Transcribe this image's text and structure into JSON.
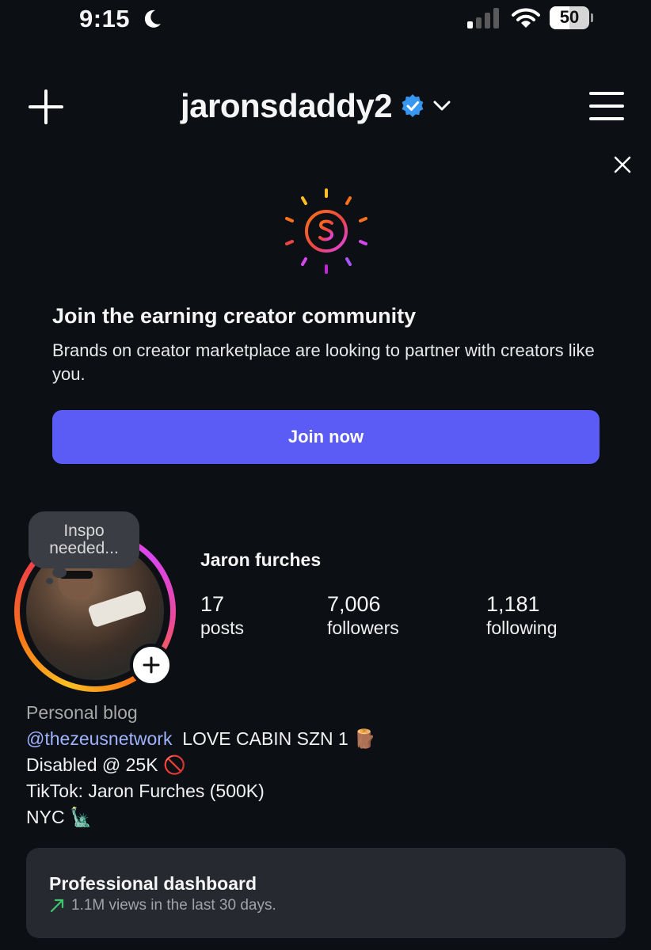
{
  "status_bar": {
    "time": "9:15",
    "battery_percent": "50",
    "battery_level": 0.5,
    "icons": [
      "moon-icon",
      "signal-icon",
      "wifi-icon",
      "battery-icon"
    ]
  },
  "header": {
    "username": "jaronsdaddy2",
    "icons": [
      "plus-icon",
      "verified-badge-icon",
      "chevron-down-icon",
      "menu-icon"
    ]
  },
  "creator_card": {
    "title": "Join the earning creator community",
    "description": "Brands on creator marketplace are looking to partner with creators like you.",
    "button_label": "Join now",
    "icons": [
      "dollar-coin-icon",
      "close-icon"
    ],
    "button_color": "#5b5cf6"
  },
  "profile": {
    "note": "Inspo needed...",
    "display_name": "Jaron furches",
    "stats": [
      {
        "value": "17",
        "label": "posts"
      },
      {
        "value": "7,006",
        "label": "followers"
      },
      {
        "value": "1,181",
        "label": "following"
      }
    ]
  },
  "bio": {
    "category": "Personal blog",
    "mention": "@thezeusnetwork",
    "line1_rest": "LOVE CABIN SZN 1 🪵",
    "line2": "Disabled @ 25K 🚫",
    "line3": "TikTok: Jaron Furches (500K)",
    "line4": "NYC 🗽"
  },
  "dashboard": {
    "title": "Professional dashboard",
    "subtitle": "1.1M views in the last 30 days.",
    "icons": [
      "trend-up-icon"
    ],
    "trend_color": "#3ec46d"
  }
}
